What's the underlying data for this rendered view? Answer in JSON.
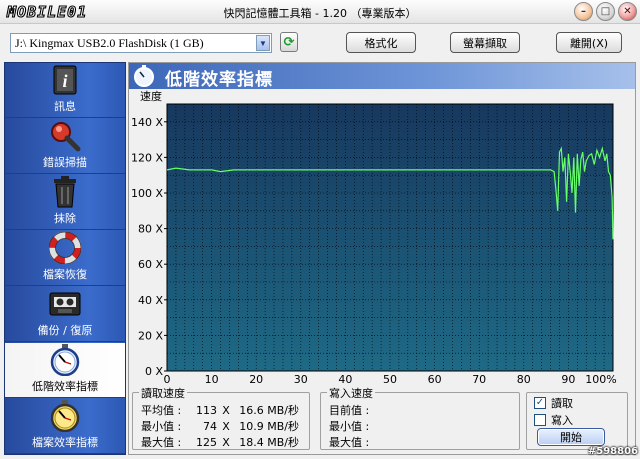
{
  "window": {
    "logo_text": "MOBILE01",
    "title": "快閃記憶體工具箱 - 1.20 （專業版本）"
  },
  "toolbar": {
    "drive": "J:\\ Kingmax USB2.0 FlashDisk (1 GB)",
    "format_label": "格式化",
    "screenshot_label": "螢幕擷取",
    "exit_label": "離開(X)"
  },
  "sidebar": {
    "items": [
      {
        "label": "訊息",
        "icon": "info-icon"
      },
      {
        "label": "錯誤掃描",
        "icon": "magnifier-icon"
      },
      {
        "label": "抹除",
        "icon": "trash-icon"
      },
      {
        "label": "檔案恢復",
        "icon": "lifebuoy-icon"
      },
      {
        "label": "備份 / 復原",
        "icon": "tape-icon"
      },
      {
        "label": "低階效率指標",
        "icon": "stopwatch-icon",
        "active": true
      },
      {
        "label": "檔案效率指標",
        "icon": "stopwatch-gold-icon"
      }
    ]
  },
  "panel": {
    "title": "低階效率指標"
  },
  "chart_data": {
    "type": "line",
    "ylabel": "速度",
    "ylim": [
      0,
      150
    ],
    "yticks": [
      "0 X",
      "20 X",
      "40 X",
      "60 X",
      "80 X",
      "100 X",
      "120 X",
      "140 X"
    ],
    "ytick_values": [
      0,
      20,
      40,
      60,
      80,
      100,
      120,
      140
    ],
    "xlim": [
      0,
      100
    ],
    "xticks": [
      "0",
      "10",
      "20",
      "30",
      "40",
      "50",
      "60",
      "70",
      "80",
      "90",
      "100%"
    ],
    "xtick_values": [
      0,
      10,
      20,
      30,
      40,
      50,
      60,
      70,
      80,
      90,
      100
    ],
    "series": [
      {
        "x": [
          0,
          2,
          5,
          8,
          10,
          12,
          15,
          18,
          20,
          25,
          30,
          35,
          40,
          45,
          50,
          55,
          60,
          65,
          70,
          75,
          80,
          84,
          86,
          86.8,
          87.2,
          87.6,
          88,
          88.4,
          88.8,
          89.2,
          89.6,
          90,
          90.4,
          90.8,
          91.2,
          91.6,
          92,
          92.4,
          92.8,
          93.2,
          93.6,
          94,
          94.6,
          95.2,
          95.8,
          96.4,
          97,
          97.6,
          98.2,
          98.6,
          99,
          99.4,
          99.8,
          100
        ],
        "y": [
          113,
          114,
          113,
          113,
          113,
          112,
          113,
          113,
          113,
          113,
          113,
          113,
          113,
          113,
          113,
          113,
          113,
          113,
          113,
          113,
          113,
          113,
          113,
          112,
          102,
          90,
          123,
          125,
          112,
          120,
          95,
          122,
          112,
          100,
          120,
          89,
          122,
          104,
          119,
          123,
          112,
          118,
          121,
          122,
          116,
          124,
          120,
          125,
          118,
          122,
          112,
          110,
          98,
          74
        ]
      }
    ],
    "colors": {
      "line": "#66ff66",
      "background": "#1a4470"
    },
    "grid": true
  },
  "read_stats": {
    "title": "讀取速度",
    "rows": [
      {
        "label": "平均值 :",
        "x": "113",
        "unit": "X",
        "mb": "16.6 MB/秒"
      },
      {
        "label": "最小值 :",
        "x": "74",
        "unit": "X",
        "mb": "10.9 MB/秒"
      },
      {
        "label": "最大值 :",
        "x": "125",
        "unit": "X",
        "mb": "18.4 MB/秒"
      }
    ]
  },
  "write_stats": {
    "title": "寫入速度",
    "rows": [
      {
        "label": "目前值 :"
      },
      {
        "label": "最小值 :"
      },
      {
        "label": "最大值 :"
      }
    ]
  },
  "options": {
    "read_label": "讀取",
    "read_checked": "✓",
    "write_label": "寫入",
    "start_label": "開始"
  },
  "watermark": "#598806"
}
